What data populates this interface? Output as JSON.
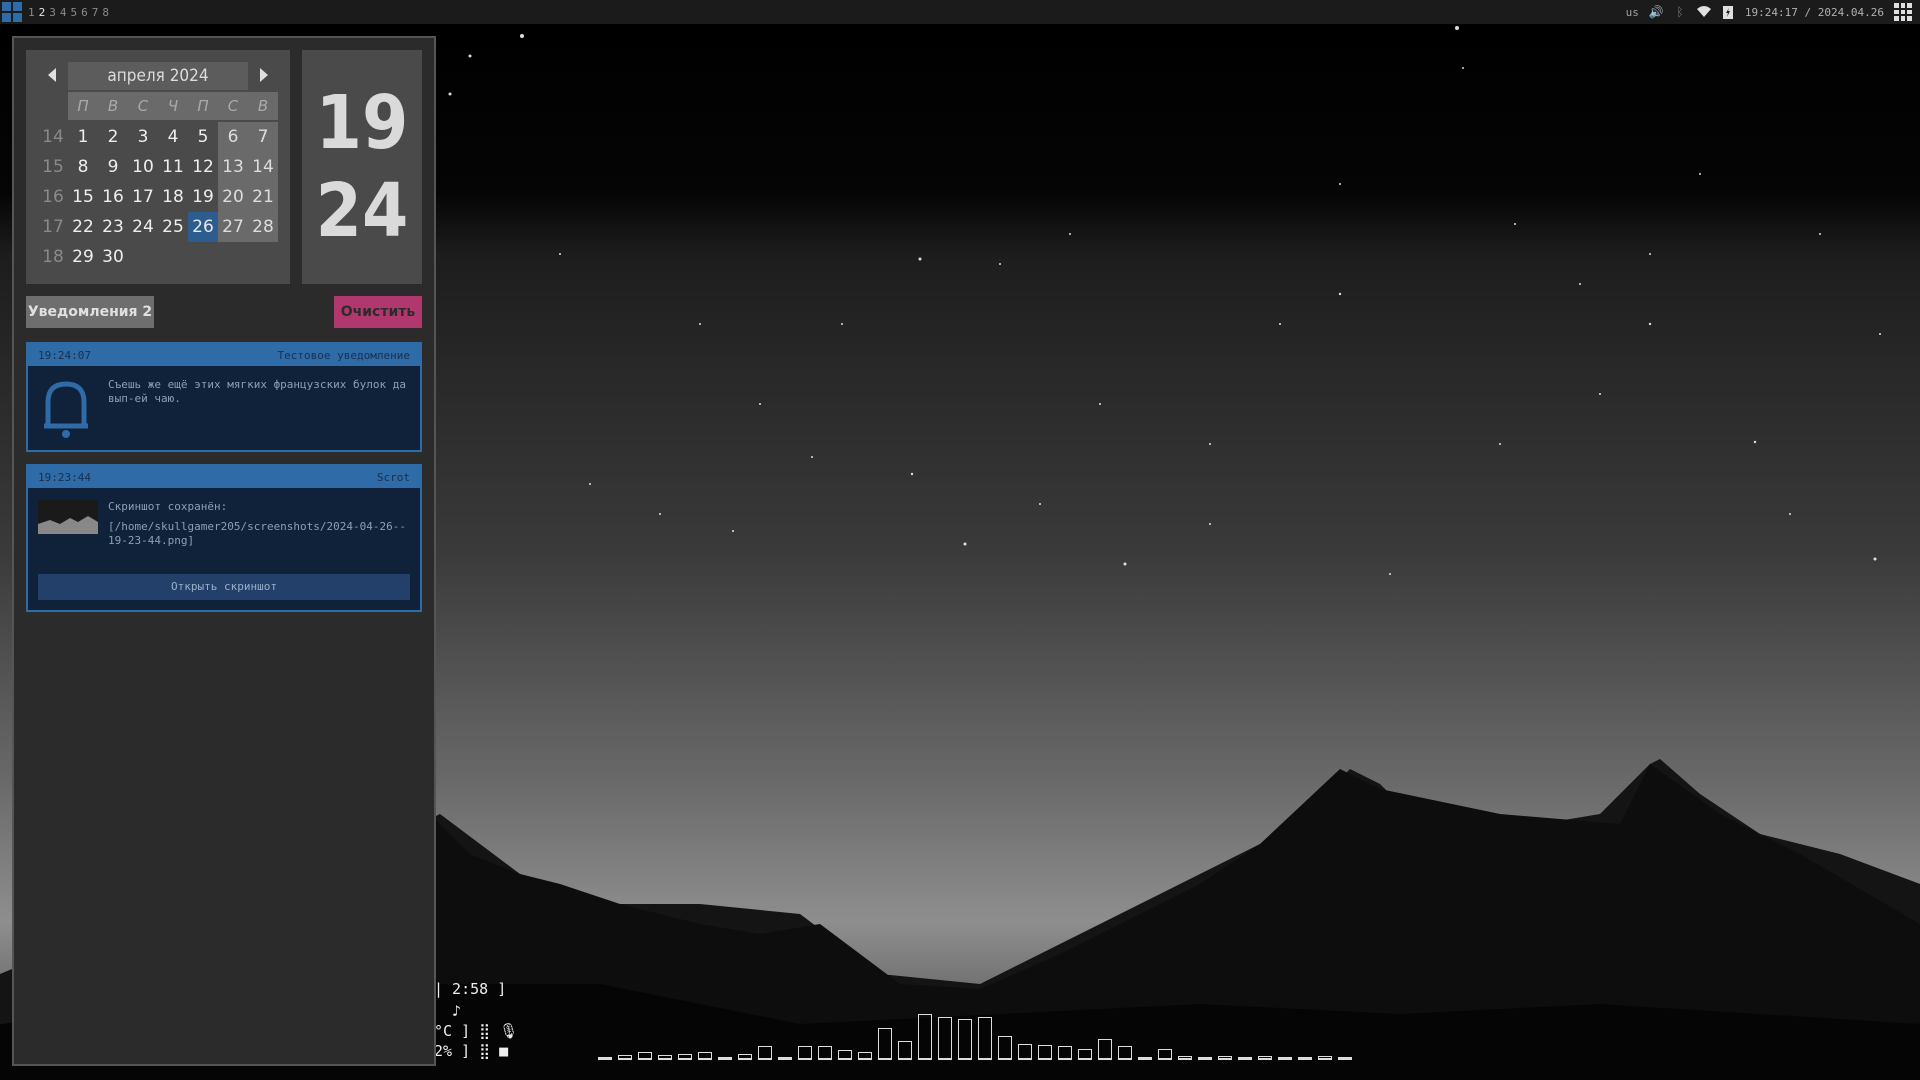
{
  "topbar": {
    "workspaces": [
      "1",
      "2",
      "3",
      "4",
      "5",
      "6",
      "7",
      "8"
    ],
    "active_workspace": "2",
    "keyboard_layout": "us",
    "clock": "19:24:17 / 2024.04.26"
  },
  "calendar": {
    "month_year": "апреля 2024",
    "weekdays": [
      "П",
      "В",
      "С",
      "Ч",
      "П",
      "С",
      "В"
    ],
    "weeks": [
      {
        "num": "14",
        "days": [
          "",
          "1",
          "2",
          "3",
          "4",
          "5",
          "6",
          "7"
        ]
      },
      {
        "num": "15",
        "days": [
          "",
          "8",
          "9",
          "10",
          "11",
          "12",
          "13",
          "14"
        ]
      },
      {
        "num": "16",
        "days": [
          "",
          "15",
          "16",
          "17",
          "18",
          "19",
          "20",
          "21"
        ]
      },
      {
        "num": "17",
        "days": [
          "",
          "22",
          "23",
          "24",
          "25",
          "26",
          "27",
          "28"
        ]
      },
      {
        "num": "18",
        "days": [
          "",
          "29",
          "30",
          "",
          "",
          "",
          "",
          ""
        ]
      }
    ],
    "today": "26"
  },
  "big_clock": {
    "hours": "19",
    "minutes": "24"
  },
  "notifications": {
    "count_label": "Уведомления 2",
    "clear_label": "Очистить",
    "items": [
      {
        "time": "19:24:07",
        "title": "Тестовое уведомление",
        "body": "Съешь же ещё этих мягких французских булок да вып-ей чаю."
      },
      {
        "time": "19:23:44",
        "title": "Scrot",
        "body": "Скриншот сохранён:",
        "path": "[/home/skullgamer205/screenshots/2024-04-26--19-23-44.png]",
        "action_label": "Открыть скриншот"
      }
    ]
  },
  "conky": {
    "line1": "| 2:58 ]",
    "line2": "♪",
    "line3": "°C ] ⣿ 🎙",
    "line4": "2% ] ⣿ ■"
  },
  "visualizer": {
    "levels": [
      0.05,
      0.1,
      0.15,
      0.1,
      0.12,
      0.15,
      0.05,
      0.12,
      0.25,
      0.0,
      0.25,
      0.25,
      0.18,
      0.15,
      0.6,
      0.35,
      0.85,
      0.8,
      0.75,
      0.8,
      0.45,
      0.3,
      0.28,
      0.25,
      0.2,
      0.38,
      0.25,
      0.05,
      0.2,
      0.08,
      0.06,
      0.08,
      0.06,
      0.08,
      0.06,
      0.05,
      0.08,
      0.05
    ]
  }
}
